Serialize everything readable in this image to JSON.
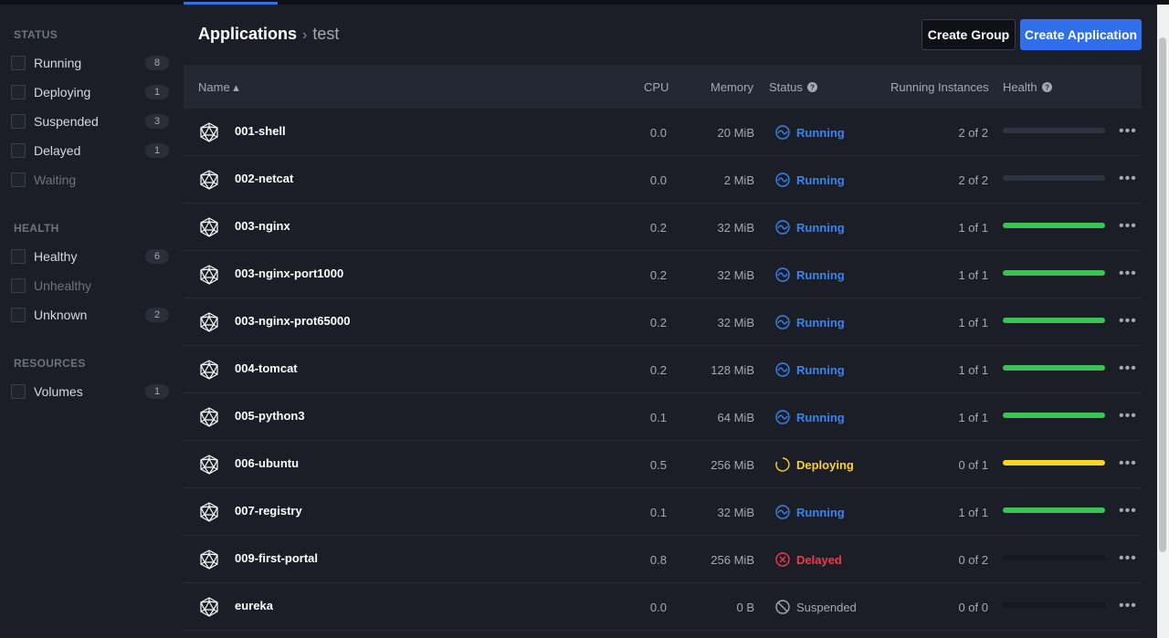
{
  "sidebar": {
    "status_heading": "STATUS",
    "status_items": [
      {
        "label": "Running",
        "count": "8",
        "dim": false
      },
      {
        "label": "Deploying",
        "count": "1",
        "dim": false
      },
      {
        "label": "Suspended",
        "count": "3",
        "dim": false
      },
      {
        "label": "Delayed",
        "count": "1",
        "dim": false
      },
      {
        "label": "Waiting",
        "count": "",
        "dim": true
      }
    ],
    "health_heading": "HEALTH",
    "health_items": [
      {
        "label": "Healthy",
        "count": "6",
        "dim": false
      },
      {
        "label": "Unhealthy",
        "count": "",
        "dim": true
      },
      {
        "label": "Unknown",
        "count": "2",
        "dim": false
      }
    ],
    "resources_heading": "RESOURCES",
    "resource_items": [
      {
        "label": "Volumes",
        "count": "1",
        "dim": false
      }
    ]
  },
  "breadcrumb": {
    "root": "Applications",
    "separator": "›",
    "current": "test"
  },
  "buttons": {
    "create_group": "Create Group",
    "create_application": "Create Application"
  },
  "table": {
    "headers": {
      "name": "Name ▴",
      "cpu": "CPU",
      "memory": "Memory",
      "status": "Status",
      "instances": "Running Instances",
      "health": "Health"
    },
    "rows": [
      {
        "name": "001-shell",
        "cpu": "0.0",
        "memory": "20 MiB",
        "status": "Running",
        "instances": "2 of 2",
        "health": 0,
        "health_color": "#2e3342"
      },
      {
        "name": "002-netcat",
        "cpu": "0.0",
        "memory": "2 MiB",
        "status": "Running",
        "instances": "2 of 2",
        "health": 0,
        "health_color": "#2e3342"
      },
      {
        "name": "003-nginx",
        "cpu": "0.2",
        "memory": "32 MiB",
        "status": "Running",
        "instances": "1 of 1",
        "health": 1,
        "health_color": "#3cc153"
      },
      {
        "name": "003-nginx-port1000",
        "cpu": "0.2",
        "memory": "32 MiB",
        "status": "Running",
        "instances": "1 of 1",
        "health": 1,
        "health_color": "#3cc153"
      },
      {
        "name": "003-nginx-prot65000",
        "cpu": "0.2",
        "memory": "32 MiB",
        "status": "Running",
        "instances": "1 of 1",
        "health": 1,
        "health_color": "#3cc153"
      },
      {
        "name": "004-tomcat",
        "cpu": "0.2",
        "memory": "128 MiB",
        "status": "Running",
        "instances": "1 of 1",
        "health": 1,
        "health_color": "#3cc153"
      },
      {
        "name": "005-python3",
        "cpu": "0.1",
        "memory": "64 MiB",
        "status": "Running",
        "instances": "1 of 1",
        "health": 1,
        "health_color": "#3cc153"
      },
      {
        "name": "006-ubuntu",
        "cpu": "0.5",
        "memory": "256 MiB",
        "status": "Deploying",
        "instances": "0 of 1",
        "health": 1,
        "health_color": "#fcd523"
      },
      {
        "name": "007-registry",
        "cpu": "0.1",
        "memory": "32 MiB",
        "status": "Running",
        "instances": "1 of 1",
        "health": 1,
        "health_color": "#3cc153"
      },
      {
        "name": "009-first-portal",
        "cpu": "0.8",
        "memory": "256 MiB",
        "status": "Delayed",
        "instances": "0 of 2",
        "health": 0,
        "health_color": "#16181e"
      },
      {
        "name": "eureka",
        "cpu": "0.0",
        "memory": "0 B",
        "status": "Suspended",
        "instances": "0 of 0",
        "health": 0,
        "health_color": "#16181e"
      }
    ]
  },
  "colors": {
    "accent": "#2f6fea",
    "running": "#3a82f7",
    "deploying": "#fcd523",
    "delayed": "#ef3b4b",
    "suspended": "#a4a9b3",
    "healthy": "#3cc153"
  },
  "icons": {
    "app": "app-cube-icon",
    "status_help": "help-circle-icon",
    "more": "more-dots-icon"
  }
}
